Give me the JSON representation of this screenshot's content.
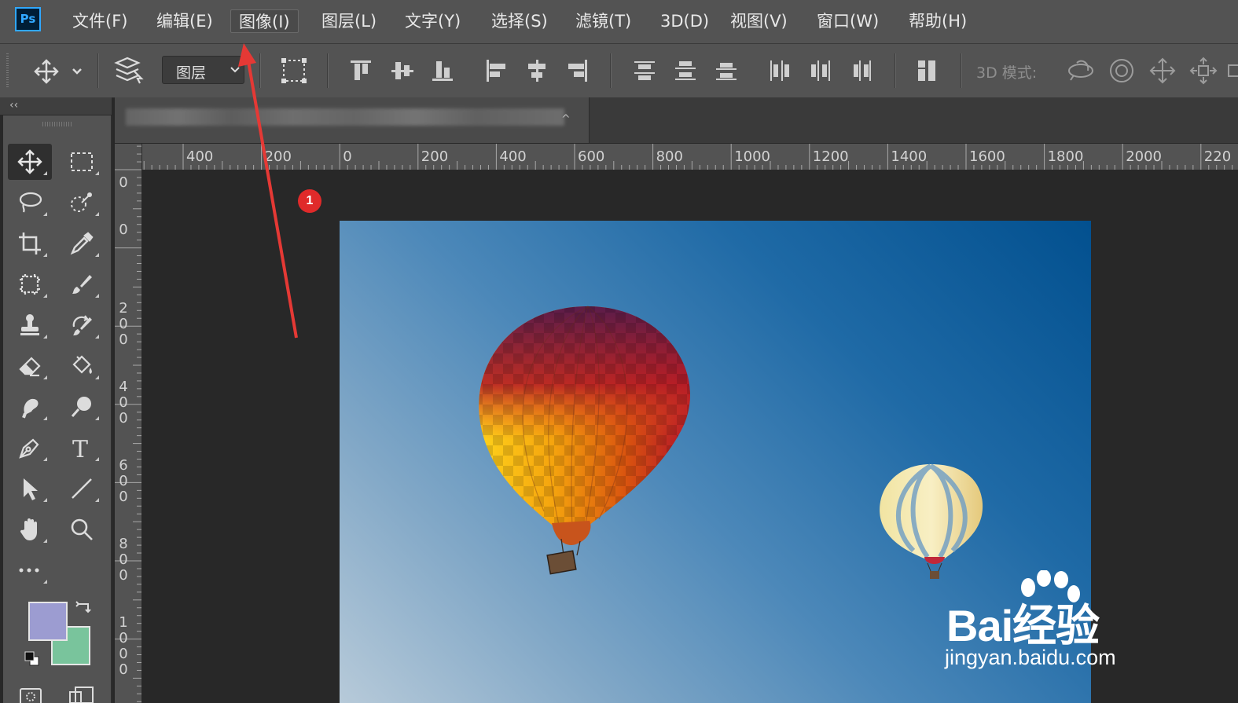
{
  "app": {
    "logo_text": "Ps"
  },
  "menu": [
    {
      "id": "file",
      "label": "文件(F)"
    },
    {
      "id": "edit",
      "label": "编辑(E)"
    },
    {
      "id": "image",
      "label": "图像(I)"
    },
    {
      "id": "layer",
      "label": "图层(L)"
    },
    {
      "id": "type",
      "label": "文字(Y)"
    },
    {
      "id": "select",
      "label": "选择(S)"
    },
    {
      "id": "filter",
      "label": "滤镜(T)"
    },
    {
      "id": "3d",
      "label": "3D(D)"
    },
    {
      "id": "view",
      "label": "视图(V)"
    },
    {
      "id": "window",
      "label": "窗口(W)"
    },
    {
      "id": "help",
      "label": "帮助(H)"
    }
  ],
  "menu_active": "图像(I)",
  "options": {
    "auto_select_target": "图层",
    "mode_3d_label": "3D 模式:"
  },
  "panel": {
    "collapse_glyph": "‹‹"
  },
  "doc_tab": {
    "title": "",
    "chevron": "^"
  },
  "rulers": {
    "horizontal_labels": [
      "400",
      "200",
      "0",
      "200",
      "400",
      "600",
      "800",
      "1000",
      "1200",
      "1400",
      "1600",
      "1800",
      "2000",
      "220"
    ],
    "vertical_labels": [
      "0",
      "0",
      "200",
      "400",
      "600",
      "800",
      "1000"
    ]
  },
  "colors": {
    "foreground": "#9c9cd1",
    "background": "#79c49c",
    "accent": "#31a8ff",
    "annotation": "#e02a2a"
  },
  "annotation": {
    "step": "1"
  },
  "watermark": {
    "brand": "Bai经验",
    "url": "jingyan.baidu.com"
  }
}
